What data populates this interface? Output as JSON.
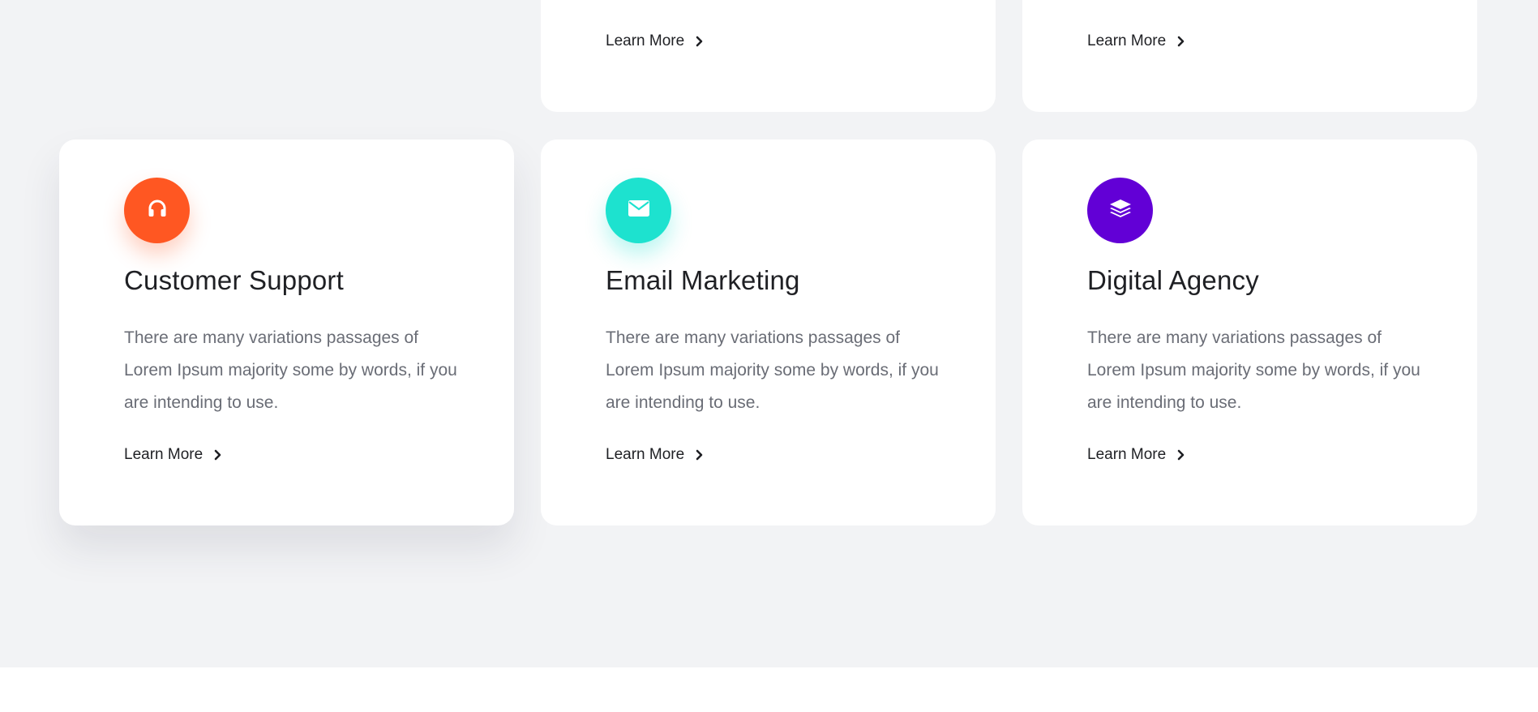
{
  "top_cards": [
    {
      "learn_more": "Learn More"
    },
    {
      "learn_more": "Learn More"
    }
  ],
  "cards": [
    {
      "title": "Customer Support",
      "description": "There are many variations passages of Lorem Ipsum majority some by words, if you are intending to use.",
      "learn_more": "Learn More",
      "icon": "headphones-icon",
      "color": "#ff5722"
    },
    {
      "title": "Email Marketing",
      "description": "There are many variations passages of Lorem Ipsum majority some by words, if you are intending to use.",
      "learn_more": "Learn More",
      "icon": "envelope-icon",
      "color": "#1de2cf"
    },
    {
      "title": "Digital Agency",
      "description": "There are many variations passages of Lorem Ipsum majority some by words, if you are intending to use.",
      "learn_more": "Learn More",
      "icon": "layers-icon",
      "color": "#6200d6"
    }
  ]
}
